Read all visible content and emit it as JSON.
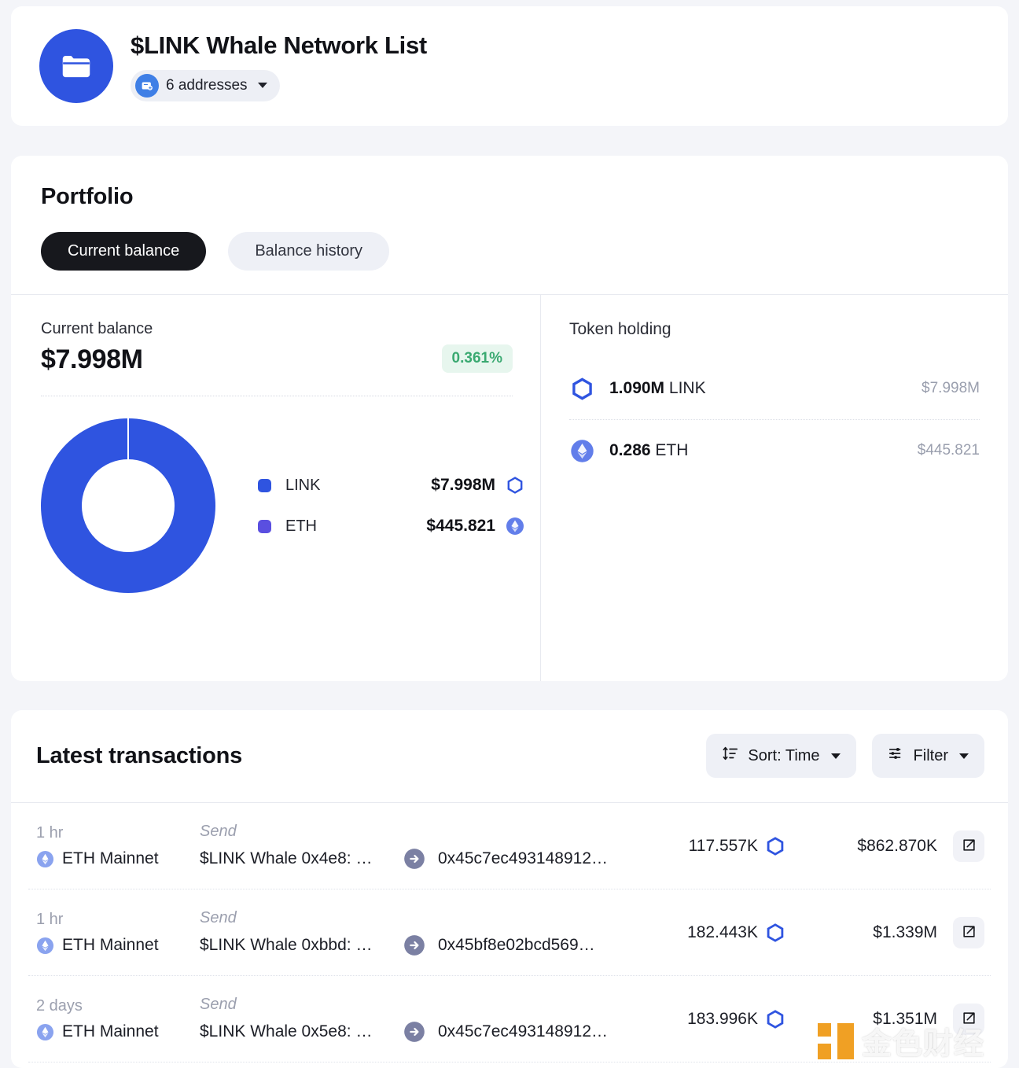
{
  "header": {
    "folder_icon": "folder-icon",
    "title": "$LINK Whale Network List",
    "addresses_label": "6 addresses",
    "wallet_icon": "wallet-icon",
    "dropdown_icon": "chevron-down-icon"
  },
  "portfolio": {
    "title": "Portfolio",
    "tabs": [
      {
        "label": "Current balance",
        "active": true
      },
      {
        "label": "Balance history",
        "active": false
      }
    ],
    "current_balance": {
      "label": "Current balance",
      "value": "$7.998M",
      "change": "0.361%",
      "change_color": "#3aa971"
    },
    "token_holding": {
      "title": "Token holding",
      "rows": [
        {
          "icon": "link-token-icon",
          "amount": "1.090M",
          "symbol": "LINK",
          "usd": "$7.998M"
        },
        {
          "icon": "eth-token-icon",
          "amount": "0.286",
          "symbol": "ETH",
          "usd": "$445.821"
        }
      ]
    }
  },
  "chart_data": {
    "type": "pie",
    "title": "Current balance allocation",
    "categories": [
      "LINK",
      "ETH"
    ],
    "values": [
      7998000,
      445.821
    ],
    "labels": [
      "$7.998M",
      "$445.821"
    ],
    "colors": [
      "#2f54e0",
      "#5a4fe0"
    ],
    "percentages": [
      99.994,
      0.006
    ],
    "legend_position": "right",
    "donut": true,
    "icons": [
      "link-token-icon",
      "eth-token-icon"
    ]
  },
  "transactions": {
    "title": "Latest transactions",
    "sort_button": {
      "label": "Sort: Time",
      "icon": "sort-icon",
      "caret": "chevron-down-icon"
    },
    "filter_button": {
      "label": "Filter",
      "icon": "filter-icon",
      "caret": "chevron-down-icon"
    },
    "rows": [
      {
        "time": "1 hr",
        "chain": "ETH Mainnet",
        "chain_icon": "eth-chain-icon",
        "type": "Send",
        "from": "$LINK Whale 0x4e8: …",
        "arrow_icon": "arrow-right-icon",
        "to": "0x45c7ec493148912…",
        "amount": "117.557K",
        "token_icon": "link-token-icon",
        "usd": "$862.870K",
        "external_icon": "external-link-icon"
      },
      {
        "time": "1 hr",
        "chain": "ETH Mainnet",
        "chain_icon": "eth-chain-icon",
        "type": "Send",
        "from": "$LINK Whale 0xbbd: …",
        "arrow_icon": "arrow-right-icon",
        "to": "0x45bf8e02bcd569…",
        "amount": "182.443K",
        "token_icon": "link-token-icon",
        "usd": "$1.339M",
        "external_icon": "external-link-icon"
      },
      {
        "time": "2 days",
        "chain": "ETH Mainnet",
        "chain_icon": "eth-chain-icon",
        "type": "Send",
        "from": "$LINK Whale 0x5e8: …",
        "arrow_icon": "arrow-right-icon",
        "to": "0x45c7ec493148912…",
        "amount": "183.996K",
        "token_icon": "link-token-icon",
        "usd": "$1.351M",
        "external_icon": "external-link-icon"
      }
    ]
  },
  "watermark": {
    "text": "金色财经",
    "mark_color": "#f0a024"
  }
}
